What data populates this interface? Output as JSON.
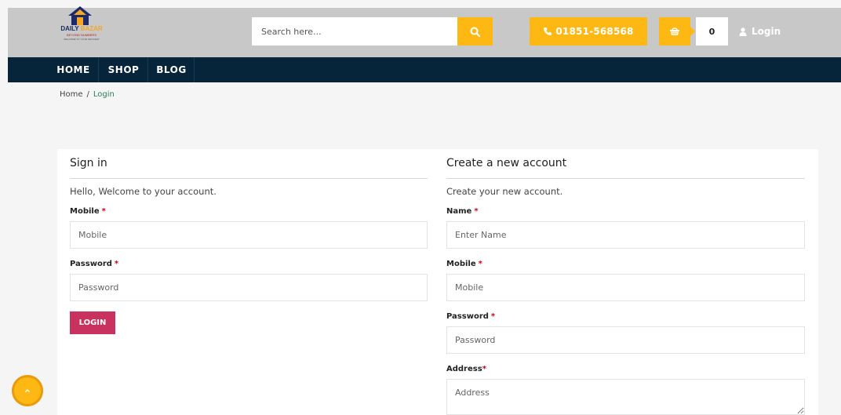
{
  "header": {
    "logo": {
      "brand_main": "DAILY",
      "brand_accent": "BAZAR",
      "tagline": "BEYOND NUMBERS",
      "subtagline": "WELCOME TO YOUR GROCERY"
    },
    "search": {
      "placeholder": "Search here...",
      "icon": "search-icon"
    },
    "phone": {
      "icon": "phone-icon",
      "number": "01851-568568"
    },
    "cart": {
      "icon": "basket-icon",
      "count": "0"
    },
    "login": {
      "icon": "user-icon",
      "label": "Login"
    }
  },
  "nav": {
    "items": [
      "HOME",
      "SHOP",
      "BLOG"
    ]
  },
  "breadcrumb": {
    "home": "Home",
    "separator": "/",
    "current": "Login"
  },
  "signin": {
    "title": "Sign in",
    "subtitle": "Hello, Welcome to your account.",
    "mobile_label": "Mobile",
    "mobile_placeholder": "Mobile",
    "password_label": "Password",
    "password_placeholder": "Password",
    "required_mark": "*",
    "button_label": "LOGIN"
  },
  "register": {
    "title": "Create a new account",
    "subtitle": "Create your new account.",
    "name_label": "Name",
    "name_placeholder": "Enter Name",
    "mobile_label": "Mobile",
    "mobile_placeholder": "Mobile",
    "password_label": "Password",
    "password_placeholder": "Password",
    "address_label": "Address",
    "address_placeholder": "Address",
    "required_mark": "*"
  },
  "colors": {
    "accent": "#fdb813",
    "nav": "#06243a",
    "login_button": "#c9315f",
    "breadcrumb_active": "#2e7d5b",
    "required": "#d0021b"
  }
}
